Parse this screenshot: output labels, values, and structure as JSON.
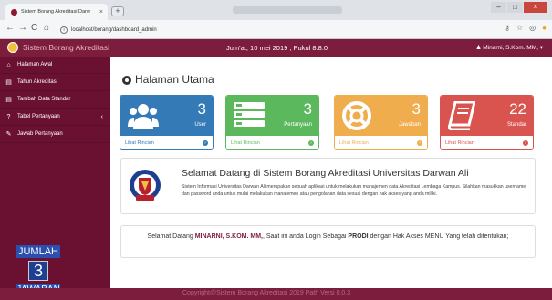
{
  "browser": {
    "tab_title": "Sistem Borang Akreditasi Darw",
    "tab_close": "×",
    "new_tab": "+",
    "back": "←",
    "forward": "→",
    "reload": "C",
    "home": "⌂",
    "url": "localhost/borang/dashboard_admin",
    "info": "i",
    "window_min": "–",
    "window_max": "□",
    "window_close": "×"
  },
  "header": {
    "brand": "Sistem Borang Akreditasi",
    "datetime": "Jum'at, 10 mei 2019 ; Pukul 8:8:0",
    "user": "Minarni, S.Kom. MM,",
    "user_caret": "▾"
  },
  "sidebar": {
    "items": [
      {
        "icon": "⌂",
        "label": "Halaman Awal"
      },
      {
        "icon": "▤",
        "label": "Tahun Akreditasi"
      },
      {
        "icon": "▤",
        "label": "Tambah Data Standar"
      },
      {
        "icon": "?",
        "label": "Tabel Pertanyaan",
        "caret": "‹"
      },
      {
        "icon": "✎",
        "label": "Jawab Pertanyaan"
      }
    ],
    "answer_widget": {
      "title": "JUMLAH",
      "count": "3",
      "label": "JAWABAN"
    }
  },
  "main": {
    "page_title": "Halaman Utama",
    "panels": [
      {
        "count": "3",
        "caption": "User",
        "link": "Lihat Rincian",
        "color": "#337ab7"
      },
      {
        "count": "3",
        "caption": "Pertanyaan",
        "link": "Lihat Rincian",
        "color": "#5cb85c"
      },
      {
        "count": "3",
        "caption": "Jawaban",
        "link": "Lihat Rincian",
        "color": "#f0ad4e"
      },
      {
        "count": "22",
        "caption": "Standar",
        "link": "Lihat Rincian",
        "color": "#d9534f"
      }
    ],
    "welcome": {
      "title": "Selamat Datang di Sistem Borang Akreditasi Universitas Darwan Ali",
      "description": "Sistem Informasi Universitas Darwan Ali merupakan sebuah aplikasi untuk melakukan manajemen data Akreditasi Lembaga Kampus. Silahkan masukkan username dan password anda untuk mulai melakukan manajemen atau pengolahan data sesuai dengan hak akses yang anda miliki."
    },
    "login_info": {
      "prefix": "Selamat Datang",
      "name": "MINARNI, S.KOM. MM,",
      "middle": ", Saat ini anda Login Sebagai",
      "role": "PRODI",
      "suffix": "dengan Hak Akses MENU Yang telah ditentukan;"
    }
  },
  "footer": {
    "text": "Copyright@Sistem Borang Akreditasi 2019 Path Versi 0.0.3"
  },
  "colors": {
    "header": "#7d1d3d",
    "sidebar": "#6a1131",
    "accent_user": "#7d1d3d"
  }
}
